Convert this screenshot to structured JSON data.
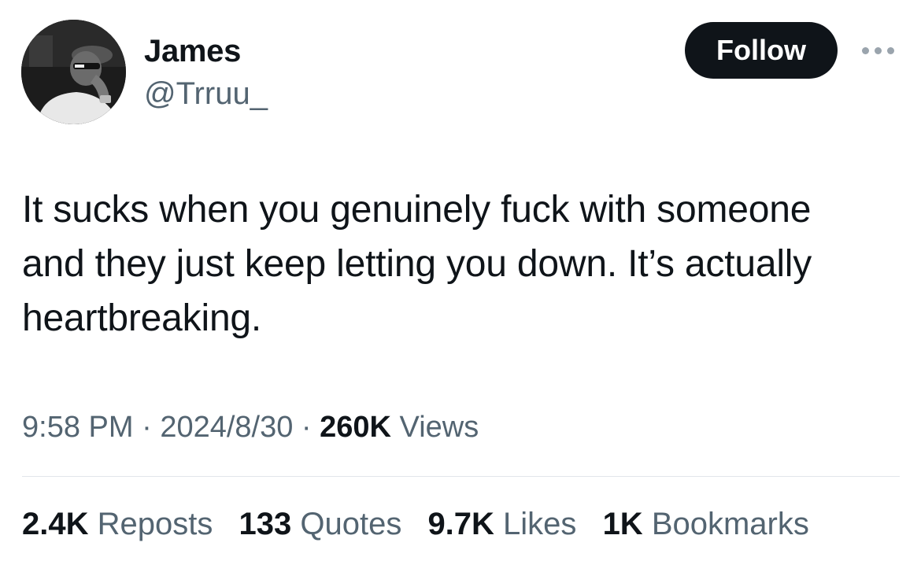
{
  "author": {
    "name": "James",
    "handle": "@Trruu_",
    "avatar_icon": "profile-photo"
  },
  "actions": {
    "follow_label": "Follow",
    "more_icon": "more-dots-icon"
  },
  "tweet": {
    "text": "It sucks when you genuinely fuck with someone\nand they just keep letting you down. It’s actually\nheartbreaking."
  },
  "meta": {
    "time": "9:58 PM",
    "sep1": " · ",
    "date": "2024/8/30",
    "sep2": " · ",
    "views_count": "260K",
    "views_label": " Views"
  },
  "stats": [
    {
      "count": "2.4K",
      "label": " Reposts"
    },
    {
      "count": "133",
      "label": " Quotes"
    },
    {
      "count": "9.7K",
      "label": " Likes"
    },
    {
      "count": "1K",
      "label": " Bookmarks"
    }
  ],
  "colors": {
    "text_primary": "#0f1419",
    "text_secondary": "#536471",
    "follow_bg": "#0f1419",
    "divider": "#e1e6ea"
  }
}
